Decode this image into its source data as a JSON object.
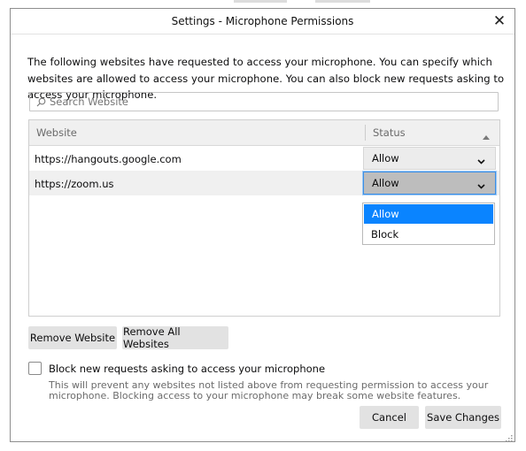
{
  "window": {
    "title": "Settings - Microphone Permissions",
    "close_label": "✕"
  },
  "description": "The following websites have requested to access your microphone. You can specify which websites are allowed to access your microphone. You can also block new requests asking to access your microphone.",
  "search": {
    "placeholder": "Search Website",
    "value": ""
  },
  "table": {
    "columns": [
      "Website",
      "Status"
    ],
    "rows": [
      {
        "website": "https://hangouts.google.com",
        "status": "Allow"
      },
      {
        "website": "https://zoom.us",
        "status": "Allow"
      }
    ]
  },
  "dropdown": {
    "options": [
      "Allow",
      "Block"
    ],
    "highlighted": "Allow"
  },
  "buttons": {
    "remove_website": "Remove Website",
    "remove_all": "Remove All Websites",
    "cancel": "Cancel",
    "save": "Save Changes"
  },
  "block_new": {
    "label": "Block new requests asking to access your microphone",
    "checked": false,
    "hint": "This will prevent any websites not listed above from requesting permission to access your microphone. Blocking access to your microphone may break some website features."
  },
  "colors": {
    "accent": "#0a84ff",
    "button_bg": "#e2e2e2",
    "header_bg": "#f0f0f0"
  }
}
